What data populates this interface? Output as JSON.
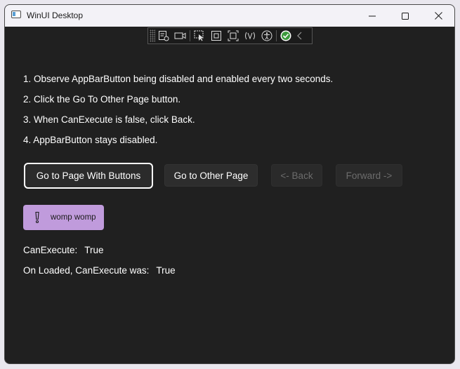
{
  "window": {
    "title": "WinUI Desktop"
  },
  "toolbar": {
    "icons": [
      "select-element-icon",
      "video-icon",
      "pointer-select-icon",
      "layout-adorner-icon",
      "track-focus-icon",
      "binding-failures-icon",
      "accessibility-icon",
      "check-status-icon",
      "collapse-chevron-icon"
    ]
  },
  "instructions": [
    "1. Observe AppBarButton being disabled and enabled every two seconds.",
    "2. Click the Go To Other Page button.",
    "3. When CanExecute is false, click Back.",
    "4. AppBarButton stays disabled."
  ],
  "buttons": {
    "go_to_page_with_buttons": "Go to Page With Buttons",
    "go_to_other_page": "Go to Other Page",
    "back": "<- Back",
    "forward": "Forward ->"
  },
  "appbar_button": {
    "label": "womp womp",
    "icon": "exclamation-icon",
    "color": "#c09bdc"
  },
  "status": {
    "can_execute_label": "CanExecute:",
    "can_execute_value": "True",
    "on_loaded_label": "On Loaded, CanExecute was:",
    "on_loaded_value": "True"
  }
}
